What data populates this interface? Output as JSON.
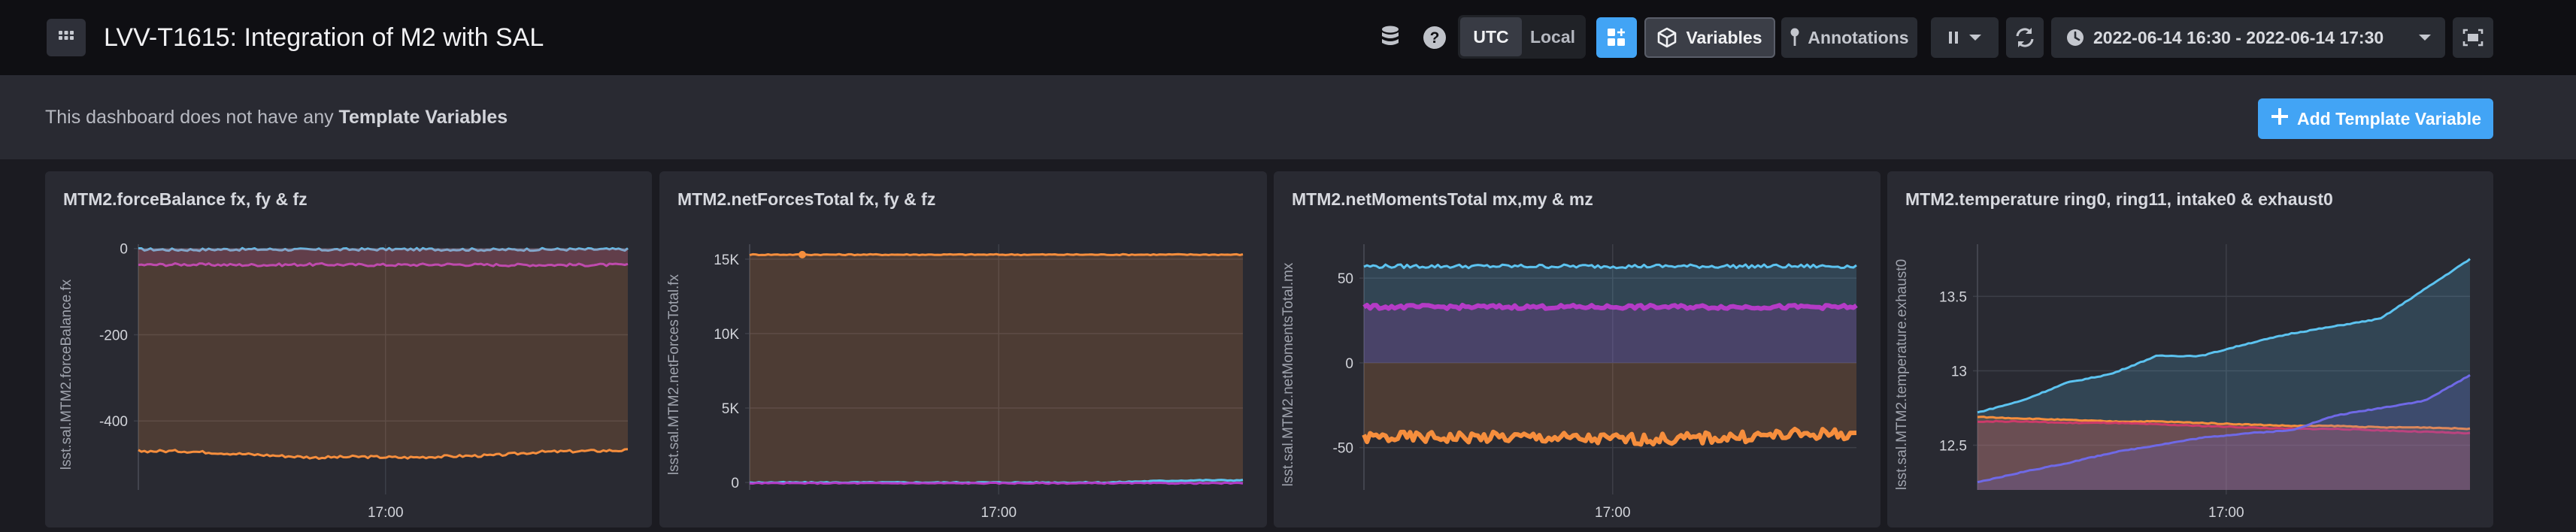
{
  "header": {
    "title": "LVV-T1615: Integration of M2 with SAL",
    "timezone_options": [
      "UTC",
      "Local"
    ],
    "timezone_selected": "UTC",
    "variables_label": "Variables",
    "annotations_label": "Annotations",
    "time_range": "2022-06-14 16:30 - 2022-06-14 17:30",
    "icons": [
      "apps-grid-icon",
      "database-icon",
      "help-icon",
      "add-cell-icon",
      "cube-icon",
      "pin-icon",
      "pause-icon",
      "refresh-icon",
      "clock-icon",
      "presentation-mode-icon"
    ]
  },
  "template_vars": {
    "message_prefix": "This dashboard does not have any",
    "message_bold": "Template Variables",
    "add_button": "Add Template Variable"
  },
  "colors": {
    "accent": "#42a4f5",
    "cyan": "#5cc3f0",
    "magenta": "#b43bc6",
    "orange": "#f68e3d",
    "purple": "#6f69e6",
    "crimson": "#cc3b6a"
  },
  "chart_data": [
    {
      "type": "line",
      "title": "MTM2.forceBalance fx, fy & fz",
      "ylabel": "lsst.sal.MTM2.forceBalance.fx",
      "yticks": [
        0,
        -200,
        -400
      ],
      "xticks": [
        "17:00"
      ],
      "ylim": [
        -560,
        10
      ],
      "series": [
        {
          "color": "cyan",
          "values": [
            -2,
            -3,
            -2,
            -2,
            -3,
            -2,
            -2,
            -2,
            -3,
            -2,
            -2,
            -2
          ]
        },
        {
          "color": "magenta",
          "values": [
            -38,
            -37,
            -38,
            -38,
            -37,
            -38,
            -38,
            -37,
            -38,
            -38,
            -38,
            -38
          ]
        },
        {
          "color": "orange",
          "values": [
            -470,
            -470,
            -475,
            -480,
            -485,
            -483,
            -485,
            -482,
            -480,
            -472,
            -470,
            -468
          ]
        }
      ]
    },
    {
      "type": "line",
      "title": "MTM2.netForcesTotal fx, fy & fz",
      "ylabel": "lsst.sal.MTM2.netForcesTotal.fx",
      "yticks": [
        "15K",
        "10K",
        "5K",
        "0"
      ],
      "xticks": [
        "17:00"
      ],
      "ylim": [
        -500,
        16000
      ],
      "series": [
        {
          "color": "orange",
          "values": [
            15300,
            15300,
            15300,
            15300,
            15300,
            15300,
            15300,
            15300,
            15300,
            15300,
            15300,
            15300
          ]
        },
        {
          "color": "cyan",
          "values": [
            0,
            0,
            0,
            0,
            0,
            0,
            0,
            0,
            0,
            100,
            150,
            150
          ]
        },
        {
          "color": "magenta",
          "values": [
            -50,
            -50,
            -50,
            -50,
            -50,
            -50,
            -50,
            -50,
            -50,
            -50,
            -50,
            -50
          ]
        }
      ]
    },
    {
      "type": "line",
      "title": "MTM2.netMomentsTotal mx,my & mz",
      "ylabel": "lsst.sal.MTM2.netMomentsTotal.mx",
      "yticks": [
        50,
        0,
        -50
      ],
      "xticks": [
        "17:00"
      ],
      "ylim": [
        -75,
        70
      ],
      "series": [
        {
          "color": "cyan",
          "values": [
            57,
            57,
            57,
            57,
            57,
            57,
            57,
            57,
            57,
            57,
            57,
            57
          ]
        },
        {
          "color": "magenta",
          "values": [
            33,
            33,
            33,
            33,
            33,
            33,
            33,
            33,
            33,
            33,
            33,
            33
          ]
        },
        {
          "color": "orange",
          "values": [
            -44,
            -44,
            -44,
            -44,
            -44,
            -45,
            -45,
            -45,
            -44,
            -43,
            -42,
            -42
          ]
        }
      ]
    },
    {
      "type": "line",
      "title": "MTM2.temperature ring0, ring11, intake0 & exhaust0",
      "ylabel": "lsst.sal.MTM2.temperature.exhaust0",
      "yticks": [
        13.5,
        13,
        12.5
      ],
      "xticks": [
        "17:00"
      ],
      "ylim": [
        12.2,
        13.85
      ],
      "series": [
        {
          "color": "cyan",
          "values": [
            12.72,
            12.8,
            12.92,
            12.98,
            13.1,
            13.1,
            13.18,
            13.25,
            13.3,
            13.35,
            13.55,
            13.75
          ]
        },
        {
          "color": "orange",
          "values": [
            12.69,
            12.68,
            12.67,
            12.66,
            12.66,
            12.65,
            12.64,
            12.63,
            12.63,
            12.62,
            12.62,
            12.61
          ]
        },
        {
          "color": "crimson",
          "values": [
            12.66,
            12.66,
            12.65,
            12.65,
            12.64,
            12.63,
            12.62,
            12.61,
            12.61,
            12.6,
            12.59,
            12.58
          ]
        },
        {
          "color": "purple",
          "values": [
            12.25,
            12.32,
            12.38,
            12.45,
            12.5,
            12.55,
            12.58,
            12.6,
            12.7,
            12.75,
            12.8,
            12.97
          ]
        }
      ]
    }
  ]
}
